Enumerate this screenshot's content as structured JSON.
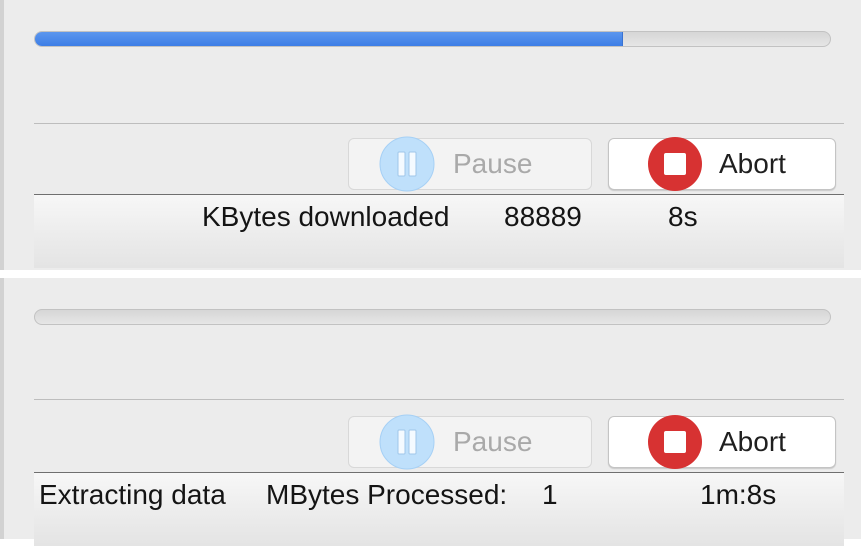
{
  "panels": [
    {
      "progress": 0.74,
      "pause_label": "Pause",
      "abort_label": "Abort",
      "status": {
        "label": "KBytes downloaded",
        "value": "88889",
        "time": "8s"
      }
    },
    {
      "progress": 0.0,
      "pause_label": "Pause",
      "abort_label": "Abort",
      "status": {
        "prefix": "Extracting data",
        "label": "MBytes Processed:",
        "value": "1",
        "time": "1m:8s"
      }
    }
  ],
  "icons": {
    "pause": "pause-icon",
    "abort": "stop-icon"
  },
  "colors": {
    "progress_fill": "#3d7ee6",
    "pause_icon_bg": "#bfe0fb",
    "abort_icon_bg": "#d73232"
  }
}
